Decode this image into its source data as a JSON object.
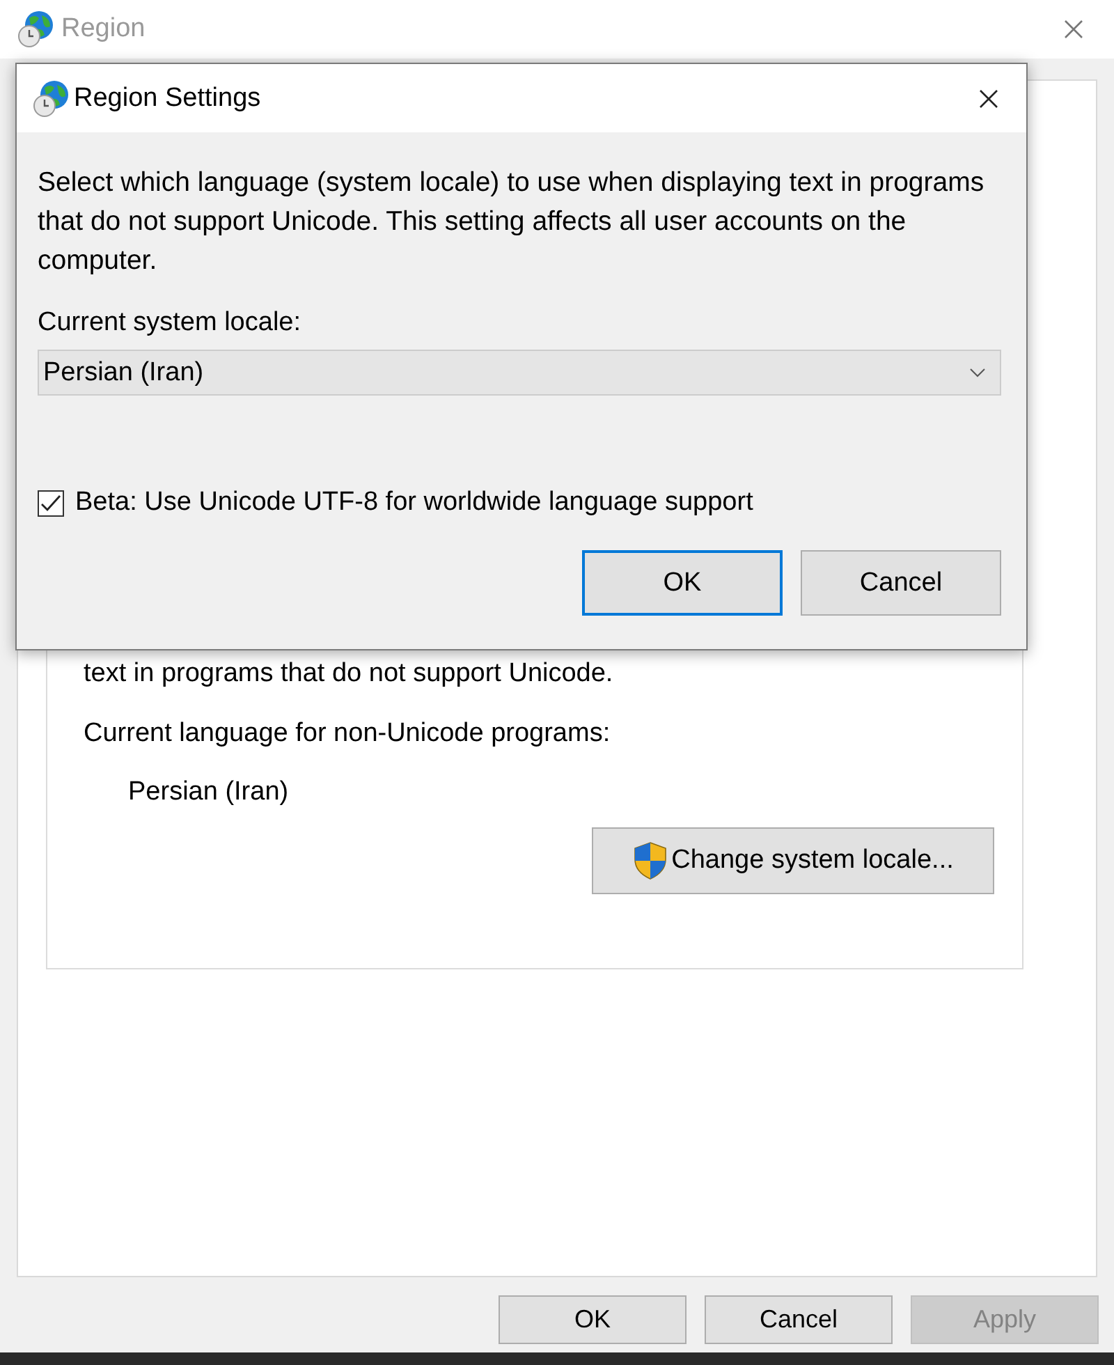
{
  "window": {
    "title": "Region"
  },
  "panel": {
    "partial_text": "text in programs that do not support Unicode.",
    "current_language_label": "Current language for non-Unicode programs:",
    "current_language": "Persian (Iran)",
    "change_button": "Change system locale..."
  },
  "buttons": [
    {
      "label": "OK",
      "disabled": false
    },
    {
      "label": "Cancel",
      "disabled": false
    },
    {
      "label": "Apply",
      "disabled": true
    }
  ],
  "dialog": {
    "title": "Region Settings",
    "description": "Select which language (system locale) to use when displaying text in programs that do not support Unicode. This setting affects all user accounts on the computer.",
    "locale_label": "Current system locale:",
    "locale_value": "Persian (Iran)",
    "beta_checkbox": {
      "label": "Beta: Use Unicode UTF-8 for worldwide language support",
      "checked": true
    },
    "buttons": [
      {
        "label": "OK",
        "default": true
      },
      {
        "label": "Cancel",
        "default": false
      }
    ]
  }
}
